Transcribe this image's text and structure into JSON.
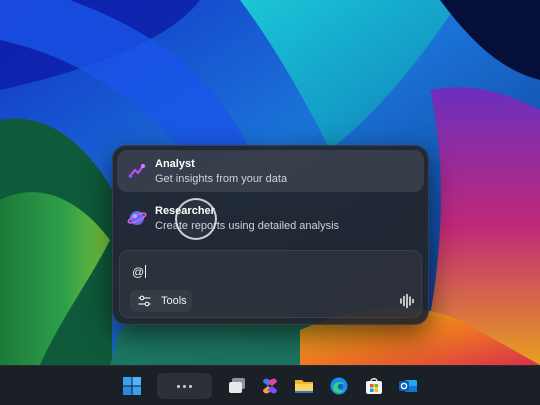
{
  "copilot": {
    "suggestions": [
      {
        "title": "Analyst",
        "description": "Get insights from your data",
        "icon": "analyst-icon"
      },
      {
        "title": "Researcher",
        "description": "Create reports using detailed analysis",
        "icon": "researcher-icon"
      }
    ],
    "input": {
      "value": "@"
    },
    "tools_label": "Tools",
    "tools_icon": "sliders-icon",
    "voice_icon": "voice-waveform-icon"
  },
  "taskbar": {
    "items": [
      {
        "name": "start-button",
        "icon": "windows-logo-icon"
      },
      {
        "name": "task-view-more",
        "icon": "ellipsis-icon"
      },
      {
        "name": "task-view",
        "icon": "task-view-icon"
      },
      {
        "name": "microsoft-365-copilot",
        "icon": "m365-copilot-icon"
      },
      {
        "name": "file-explorer",
        "icon": "folder-icon"
      },
      {
        "name": "edge-browser",
        "icon": "edge-icon"
      },
      {
        "name": "microsoft-store",
        "icon": "store-icon"
      },
      {
        "name": "outlook",
        "icon": "outlook-icon"
      }
    ]
  },
  "colors": {
    "panel_background": "#22252b",
    "taskbar_background": "#1b1f26",
    "analyst_accent": "#b23cf0",
    "researcher_accent": "#5b6cf0"
  }
}
